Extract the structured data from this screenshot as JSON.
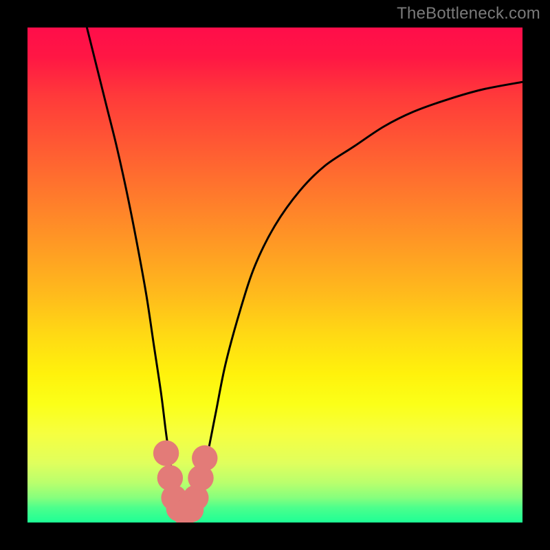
{
  "watermark": "TheBottleneck.com",
  "colors": {
    "page_bg": "#000000",
    "curve": "#000000",
    "marker_fill": "#e37b78",
    "gradient_top": "#ff0d4a",
    "gradient_bottom": "#1eff95"
  },
  "chart_data": {
    "type": "line",
    "title": "",
    "xlabel": "",
    "ylabel": "",
    "xlim": [
      0,
      100
    ],
    "ylim": [
      0,
      100
    ],
    "grid": false,
    "legend": false,
    "series": [
      {
        "name": "curve",
        "x": [
          12,
          14,
          16,
          18,
          20,
          22,
          24,
          25.5,
          27,
          28,
          29,
          30,
          31,
          32,
          33,
          34.5,
          36,
          38,
          40,
          43,
          46,
          50,
          55,
          60,
          66,
          72,
          78,
          85,
          92,
          100
        ],
        "y": [
          100,
          92,
          84,
          76,
          67,
          57,
          46,
          36,
          26,
          18,
          11,
          6,
          3,
          2,
          3,
          6,
          12,
          22,
          32,
          43,
          52,
          60,
          67,
          72,
          76,
          80,
          83,
          85.5,
          87.5,
          89
        ]
      }
    ],
    "markers": [
      {
        "x": 28.0,
        "y": 14.0,
        "r": 2.6
      },
      {
        "x": 28.8,
        "y": 9.0,
        "r": 2.6
      },
      {
        "x": 29.6,
        "y": 5.0,
        "r": 2.6
      },
      {
        "x": 30.6,
        "y": 2.8,
        "r": 2.6
      },
      {
        "x": 31.8,
        "y": 2.0,
        "r": 2.6
      },
      {
        "x": 33.0,
        "y": 2.6,
        "r": 2.6
      },
      {
        "x": 34.0,
        "y": 5.0,
        "r": 2.6
      },
      {
        "x": 35.0,
        "y": 9.0,
        "r": 2.6
      },
      {
        "x": 35.8,
        "y": 13.0,
        "r": 2.6
      }
    ]
  }
}
